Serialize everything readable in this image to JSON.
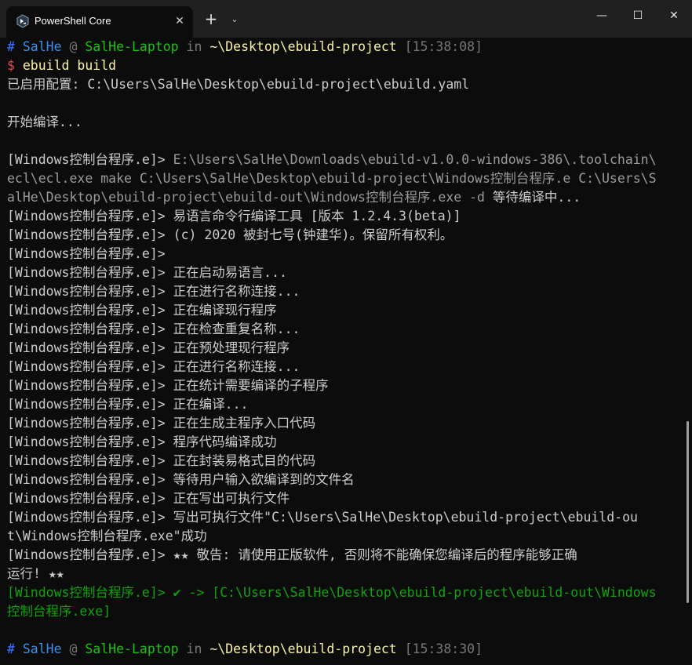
{
  "window": {
    "tab_title": "PowerShell Core",
    "tab_close": "✕",
    "new_tab": "+",
    "dropdown": "⌄",
    "minimize": "—",
    "maximize": "☐",
    "close": "✕"
  },
  "prompt1": {
    "hash": "#",
    "user": "SalHe",
    "at": "@",
    "host": "SalHe-Laptop",
    "in": "in",
    "path": "~\\Desktop\\ebuild-project",
    "time": "[15:38:08]"
  },
  "command": {
    "dollar": "$",
    "text": "ebuild build"
  },
  "output": {
    "config": "已启用配置: C:\\Users\\SalHe\\Desktop\\ebuild-project\\ebuild.yaml",
    "start": "开始编译...",
    "prefix": "[Windows控制台程序.e]>",
    "toolchain_1": "E:\\Users\\SalHe\\Downloads\\ebuild-v1.0.0-windows-386\\.toolchain\\",
    "toolchain_2": "ecl\\ecl.exe make C:\\Users\\SalHe\\Desktop\\ebuild-project\\Windows控制台程序.e C:\\Users\\S",
    "toolchain_3a": "alHe\\Desktop\\ebuild-project\\ebuild-out\\Windows控制台程序.exe -d",
    "toolchain_3b": " 等待编译中...",
    "messages": [
      " 易语言命令行编译工具 [版本 1.2.4.3(beta)]",
      " (c) 2020 被封七号(钟建华)。保留所有权利。",
      "",
      " 正在启动易语言...",
      " 正在进行名称连接...",
      " 正在编译现行程序",
      " 正在检查重复名称...",
      " 正在预处理现行程序",
      " 正在进行名称连接...",
      " 正在统计需要编译的子程序",
      " 正在编译...",
      " 正在生成主程序入口代码",
      " 程序代码编译成功",
      " 正在封装易格式目的代码",
      " 等待用户输入欲编译到的文件名",
      " 正在写出可执行文件"
    ],
    "write_1": " 写出可执行文件\"C:\\Users\\SalHe\\Desktop\\ebuild-project\\ebuild-ou",
    "write_2": "t\\Windows控制台程序.exe\"成功",
    "warn_1": " ★★ 敬告: 请使用正版软件, 否则将不能确保您编译后的程序能够正确",
    "warn_2": "运行! ★★",
    "result_1": "[Windows控制台程序.e]> ✔ -> [C:\\Users\\SalHe\\Desktop\\ebuild-project\\ebuild-out\\Windows",
    "result_2": "控制台程序.exe]"
  },
  "prompt2": {
    "hash": "#",
    "user": "SalHe",
    "at": "@",
    "host": "SalHe-Laptop",
    "in": "in",
    "path": "~\\Desktop\\ebuild-project",
    "time": "[15:38:30]"
  },
  "colors": {
    "background": "#0c0c0c",
    "titlebar": "#202020",
    "user": "#3b8eea",
    "host": "#16c60c",
    "path": "#f9f1a5",
    "error_red": "#e74856",
    "success_green": "#13a10e"
  }
}
